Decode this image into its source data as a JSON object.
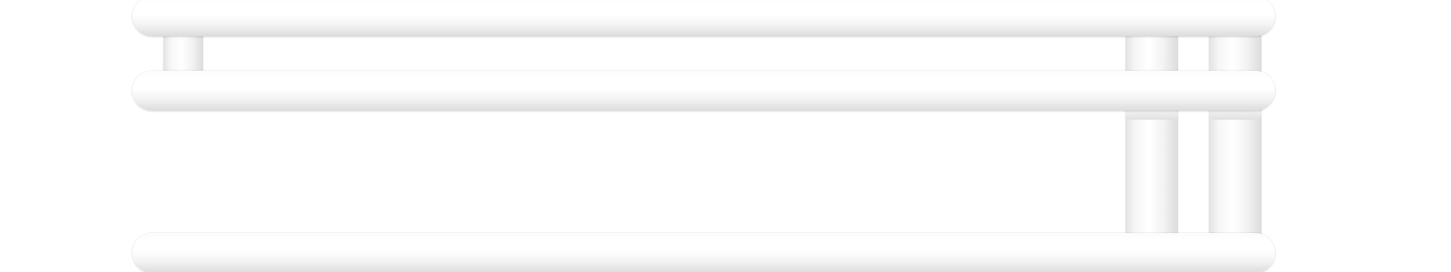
{
  "scene": {
    "subject": "towel-rail",
    "colors": {
      "background": "#ffffff",
      "rail": "#f4f4f4",
      "shadow": "#dcdcdc"
    },
    "rail_count": 3,
    "post_count": 3
  }
}
